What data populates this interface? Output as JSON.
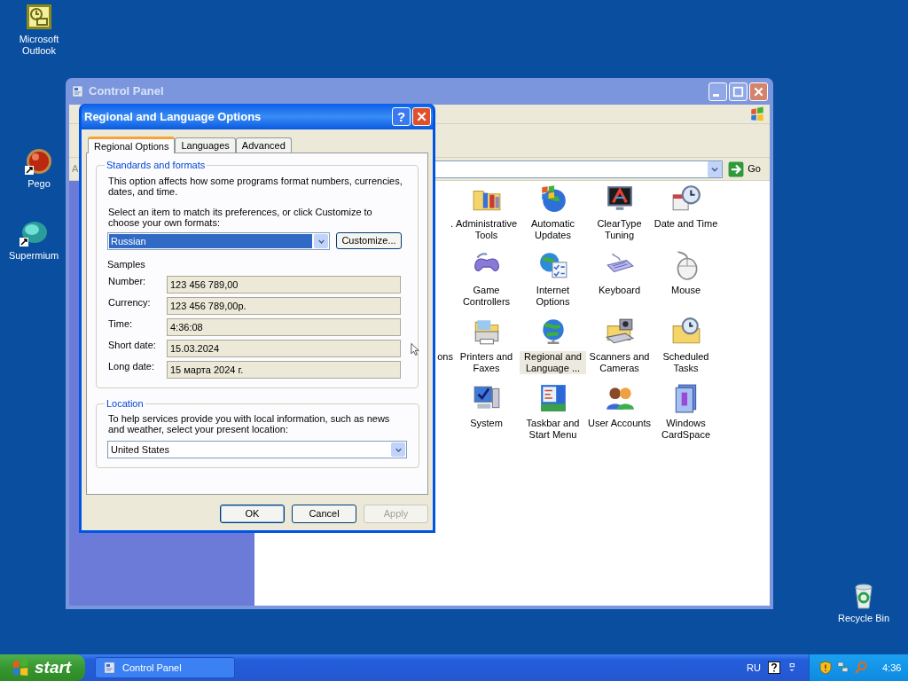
{
  "desktop_icons": [
    {
      "label": "Microsoft Outlook"
    },
    {
      "label": "Pego"
    },
    {
      "label": "Supermium"
    },
    {
      "label": "Recycle Bin"
    }
  ],
  "control_panel": {
    "title": "Control Panel",
    "address_label": "A",
    "go_button": "Go",
    "rows": [
      {
        "cut_label": ".",
        "items": [
          {
            "label": "Administrative Tools",
            "selected": false
          },
          {
            "label": "Automatic Updates",
            "selected": false
          },
          {
            "label": "ClearType Tuning",
            "selected": false
          },
          {
            "label": "Date and Time",
            "selected": false
          }
        ]
      },
      {
        "items": [
          {
            "label": "Game Controllers",
            "selected": false
          },
          {
            "label": "Internet Options",
            "selected": false
          },
          {
            "label": "Keyboard",
            "selected": false
          },
          {
            "label": "Mouse",
            "selected": false
          }
        ]
      },
      {
        "cut_label": "ons",
        "items": [
          {
            "label": "Printers and Faxes",
            "selected": false
          },
          {
            "label": "Regional and Language ...",
            "selected": true
          },
          {
            "label": "Scanners and Cameras",
            "selected": false
          },
          {
            "label": "Scheduled Tasks",
            "selected": false
          }
        ]
      },
      {
        "items": [
          {
            "label": "System",
            "selected": false
          },
          {
            "label": "Taskbar and Start Menu",
            "selected": false
          },
          {
            "label": "User Accounts",
            "selected": false
          },
          {
            "label": "Windows CardSpace",
            "selected": false
          }
        ]
      }
    ]
  },
  "dialog": {
    "title": "Regional and Language Options",
    "help_button": "?",
    "tabs": [
      {
        "label": "Regional Options",
        "selected": true
      },
      {
        "label": "Languages",
        "selected": false
      },
      {
        "label": "Advanced",
        "selected": false
      }
    ],
    "standards": {
      "legend": "Standards and formats",
      "intro": "This option affects how some programs format numbers, currencies, dates, and time.",
      "prompt": "Select an item to match its preferences, or click Customize to choose your own formats:",
      "format_select": {
        "value": "Russian"
      },
      "customize_button": "Customize...",
      "samples_heading": "Samples",
      "samples": [
        {
          "label": "Number:",
          "value": "123 456 789,00"
        },
        {
          "label": "Currency:",
          "value": "123 456 789,00р."
        },
        {
          "label": "Time:",
          "value": "4:36:08"
        },
        {
          "label": "Short date:",
          "value": "15.03.2024"
        },
        {
          "label": "Long date:",
          "value": "15 марта 2024 г."
        }
      ]
    },
    "location": {
      "legend": "Location",
      "text": "To help services provide you with local information, such as news and weather, select your present location:",
      "location_select": {
        "value": "United States"
      }
    },
    "buttons": [
      {
        "label": "OK",
        "kind": "default",
        "disabled": false
      },
      {
        "label": "Cancel",
        "kind": "normal",
        "disabled": false
      },
      {
        "label": "Apply",
        "kind": "normal",
        "disabled": true
      }
    ]
  },
  "taskbar": {
    "start": "start",
    "tasks": [
      {
        "label": "Control Panel"
      }
    ],
    "language": "RU",
    "clock": "4:36"
  }
}
